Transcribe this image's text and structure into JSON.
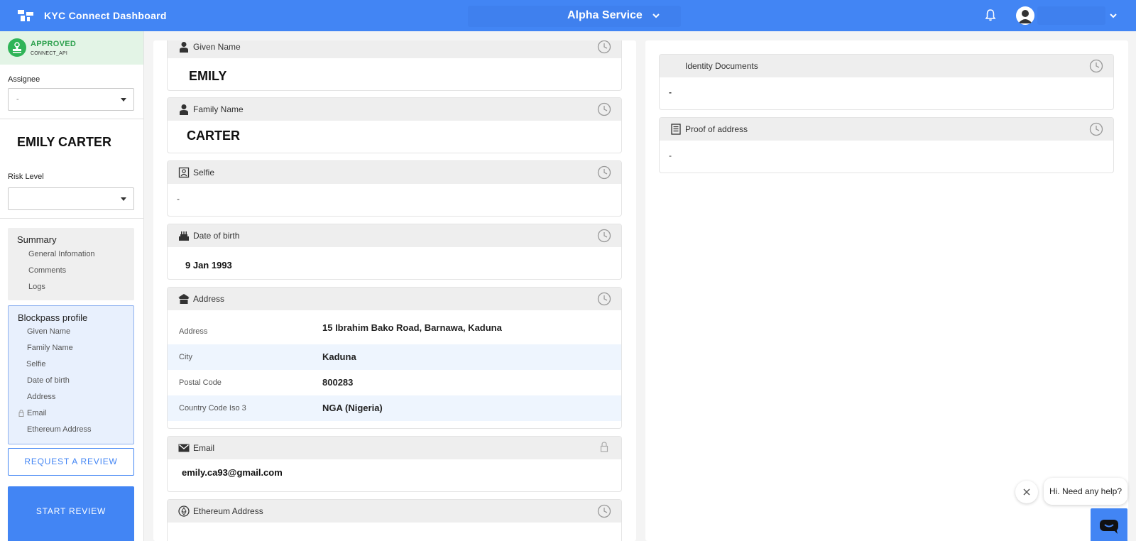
{
  "app": {
    "title": "KYC Connect Dashboard",
    "service": "Alpha Service"
  },
  "sidebar": {
    "status": "APPROVED",
    "status_source": "CONNECT_API",
    "assignee_label": "Assignee",
    "assignee_value": "-",
    "person_name": "EMILY CARTER",
    "risk_label": "Risk Level",
    "risk_value": "",
    "summary": {
      "title": "Summary",
      "items": [
        "General Infomation",
        "Comments",
        "Logs"
      ]
    },
    "profile": {
      "title": "Blockpass profile",
      "items": [
        "Given Name",
        "Family Name",
        "Selfie",
        "Date of birth",
        "Address",
        "Email",
        "Ethereum Address"
      ]
    },
    "request_review_label": "REQUEST A REVIEW",
    "start_review_label": "START REVIEW"
  },
  "profile": {
    "given_name": {
      "label": "Given Name",
      "value": "EMILY"
    },
    "family_name": {
      "label": "Family Name",
      "value": "CARTER"
    },
    "selfie": {
      "label": "Selfie",
      "value": "-"
    },
    "dob": {
      "label": "Date of birth",
      "value": "9 Jan 1993"
    },
    "address": {
      "label": "Address",
      "rows": [
        {
          "label": "Address",
          "value": "15 Ibrahim Bako Road, Barnawa, Kaduna"
        },
        {
          "label": "City",
          "value": "Kaduna"
        },
        {
          "label": "Postal Code",
          "value": "800283"
        },
        {
          "label": "Country Code Iso 3",
          "value": "NGA (Nigeria)"
        }
      ]
    },
    "email": {
      "label": "Email",
      "value": "emily.ca93@gmail.com"
    },
    "ethereum": {
      "label": "Ethereum Address"
    }
  },
  "documents": {
    "identity": {
      "label": "Identity Documents",
      "value": "-"
    },
    "proof_of_address": {
      "label": "Proof of address",
      "value": "-"
    }
  },
  "chat": {
    "message": "Hi. Need any help?"
  },
  "colors": {
    "primary": "#4285f4",
    "approved": "#2fb457",
    "approved_bg": "#e3f4e6"
  },
  "icons": [
    "logo-icon",
    "chevron-down-icon",
    "bell-icon",
    "user-avatar-icon",
    "person-icon",
    "selfie-icon",
    "cake-icon",
    "home-icon",
    "mail-icon",
    "ethereum-icon",
    "clock-icon",
    "lock-icon",
    "document-icon",
    "close-icon",
    "chat-icon"
  ]
}
